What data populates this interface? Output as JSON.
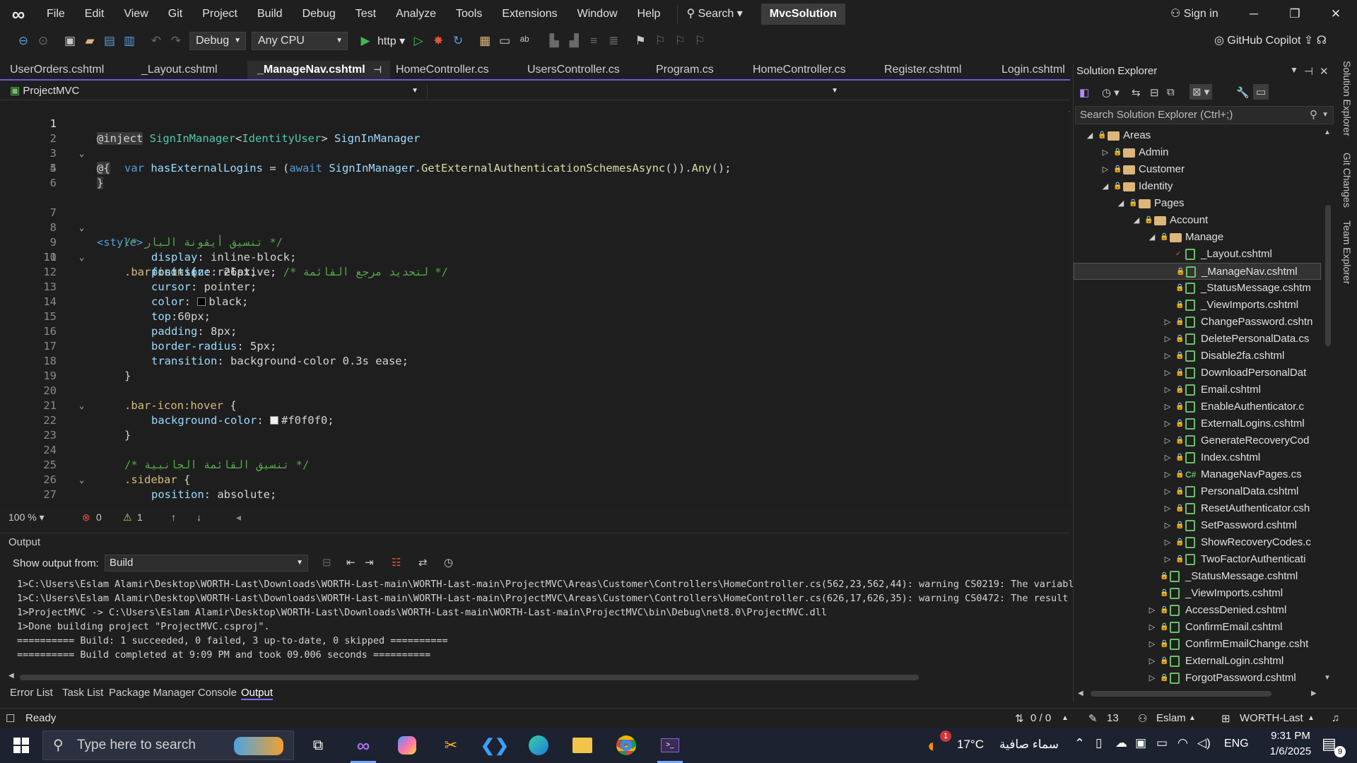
{
  "menu": {
    "items": [
      "File",
      "Edit",
      "View",
      "Git",
      "Project",
      "Build",
      "Debug",
      "Test",
      "Analyze",
      "Tools",
      "Extensions",
      "Window",
      "Help"
    ],
    "search_label": "Search",
    "solution_name": "MvcSolution",
    "sign_in": "Sign in"
  },
  "toolbar": {
    "config": "Debug",
    "platform": "Any CPU",
    "run_target": "http",
    "copilot": "GitHub Copilot"
  },
  "tabs": [
    {
      "label": "UserOrders.cshtml",
      "active": false
    },
    {
      "label": "_Layout.cshtml",
      "active": false
    },
    {
      "label": "_ManageNav.cshtml",
      "active": true
    },
    {
      "label": "HomeController.cs",
      "active": false
    },
    {
      "label": "UsersController.cs",
      "active": false
    },
    {
      "label": "Program.cs",
      "active": false
    },
    {
      "label": "HomeController.cs",
      "active": false
    },
    {
      "label": "Register.cshtml",
      "active": false
    },
    {
      "label": "Login.cshtml",
      "active": false
    }
  ],
  "navbar": {
    "project": "ProjectMVC"
  },
  "code": {
    "line_numbers": [
      "1",
      "2",
      "3",
      "4",
      "5",
      "6",
      "7",
      "8",
      "9",
      "10",
      "11",
      "12",
      "13",
      "14",
      "15",
      "16",
      "17",
      "18",
      "19",
      "20",
      "21",
      "22",
      "23",
      "24",
      "25",
      "26",
      "27"
    ],
    "l1": {
      "a": "@inject",
      "b": " SignInManager",
      "c": "<",
      "d": "IdentityUser",
      "e": "> ",
      "f": "SignInManager"
    },
    "l2": "@{",
    "l3": {
      "a": "var",
      "b": " hasExternalLogins",
      "c": " = (",
      "d": "await",
      "e": " SignInManager",
      "f": ".",
      "g": "GetExternalAuthenticationSchemesAsync",
      "h": "()).",
      "i": "Any",
      "j": "();"
    },
    "l4": "}",
    "l7": "<style>",
    "l8": "/* تنسيق أيقونة البار */",
    "l9": {
      "sel": ".bar-icon",
      "rest": " {"
    },
    "l10": {
      "p": "position",
      "v": ": relative; ",
      "c": "/* لتحديد مرجع القائمة */"
    },
    "l11": {
      "p": "display",
      "v": ": inline-block;"
    },
    "l12": {
      "p": "font-size",
      "v": ": 26px;"
    },
    "l13": {
      "p": "cursor",
      "v": ": pointer;"
    },
    "l14": {
      "p": "color",
      "v": "black;"
    },
    "l15": {
      "p": "top",
      "v": ":60px;"
    },
    "l16": {
      "p": "padding",
      "v": ": 8px;"
    },
    "l17": {
      "p": "border-radius",
      "v": ": 5px;"
    },
    "l18": {
      "p": "transition",
      "v": ": background-color 0.3s ease;"
    },
    "l19": "}",
    "l21": {
      "sel": ".bar-icon:hover",
      "rest": " {"
    },
    "l22": {
      "p": "background-color",
      "v": "#f0f0f0;"
    },
    "l23": "}",
    "l25": "/* تنسيق القائمة الجانبية */",
    "l26": {
      "sel": ".sidebar",
      "rest": " {"
    },
    "l27": {
      "p": "position",
      "v": ": absolute;"
    }
  },
  "editor_status": {
    "zoom": "100 %",
    "errors": "0",
    "warnings": "1"
  },
  "output": {
    "title": "Output",
    "show_from_label": "Show output from:",
    "source": "Build",
    "lines": [
      "1>C:\\Users\\Eslam Alamir\\Desktop\\WORTH-Last\\Downloads\\WORTH-Last-main\\WORTH-Last-main\\ProjectMVC\\Areas\\Customer\\Controllers\\HomeController.cs(562,23,562,44): warning CS0219: The variable",
      "1>C:\\Users\\Eslam Alamir\\Desktop\\WORTH-Last\\Downloads\\WORTH-Last-main\\WORTH-Last-main\\ProjectMVC\\Areas\\Customer\\Controllers\\HomeController.cs(626,17,626,35): warning CS0472: The result of",
      "1>ProjectMVC -> C:\\Users\\Eslam Alamir\\Desktop\\WORTH-Last\\Downloads\\WORTH-Last-main\\WORTH-Last-main\\ProjectMVC\\bin\\Debug\\net8.0\\ProjectMVC.dll",
      "1>Done building project \"ProjectMVC.csproj\".",
      "========== Build: 1 succeeded, 0 failed, 3 up-to-date, 0 skipped ==========",
      "========== Build completed at 9:09 PM and took 09.006 seconds =========="
    ]
  },
  "bottom_tabs": [
    "Error List",
    "Task List",
    "Package Manager Console",
    "Output"
  ],
  "solution_explorer": {
    "title": "Solution Explorer",
    "search_placeholder": "Search Solution Explorer (Ctrl+;)",
    "items": [
      {
        "label": "Areas",
        "kind": "folder",
        "expanded": true
      },
      {
        "label": "Admin",
        "kind": "folder",
        "expanded": false
      },
      {
        "label": "Customer",
        "kind": "folder",
        "expanded": false
      },
      {
        "label": "Identity",
        "kind": "folder",
        "expanded": true
      },
      {
        "label": "Pages",
        "kind": "folder",
        "expanded": true
      },
      {
        "label": "Account",
        "kind": "folder",
        "expanded": true
      },
      {
        "label": "Manage",
        "kind": "folder",
        "expanded": true
      },
      {
        "label": "_Layout.cshtml",
        "kind": "file"
      },
      {
        "label": "_ManageNav.cshtml",
        "kind": "file",
        "selected": true
      },
      {
        "label": "_StatusMessage.cshtm",
        "kind": "file"
      },
      {
        "label": "_ViewImports.cshtml",
        "kind": "file"
      },
      {
        "label": "ChangePassword.cshtn",
        "kind": "file"
      },
      {
        "label": "DeletePersonalData.cs",
        "kind": "file"
      },
      {
        "label": "Disable2fa.cshtml",
        "kind": "file"
      },
      {
        "label": "DownloadPersonalDat",
        "kind": "file"
      },
      {
        "label": "Email.cshtml",
        "kind": "file"
      },
      {
        "label": "EnableAuthenticator.c",
        "kind": "file"
      },
      {
        "label": "ExternalLogins.cshtml",
        "kind": "file"
      },
      {
        "label": "GenerateRecoveryCod",
        "kind": "file"
      },
      {
        "label": "Index.cshtml",
        "kind": "file"
      },
      {
        "label": "ManageNavPages.cs",
        "kind": "cs"
      },
      {
        "label": "PersonalData.cshtml",
        "kind": "file"
      },
      {
        "label": "ResetAuthenticator.csh",
        "kind": "file"
      },
      {
        "label": "SetPassword.cshtml",
        "kind": "file"
      },
      {
        "label": "ShowRecoveryCodes.c",
        "kind": "file"
      },
      {
        "label": "TwoFactorAuthenticati",
        "kind": "file"
      },
      {
        "label": "_StatusMessage.cshtml",
        "kind": "file"
      },
      {
        "label": "_ViewImports.cshtml",
        "kind": "file"
      },
      {
        "label": "AccessDenied.cshtml",
        "kind": "file"
      },
      {
        "label": "ConfirmEmail.cshtml",
        "kind": "file"
      },
      {
        "label": "ConfirmEmailChange.csht",
        "kind": "file"
      },
      {
        "label": "ExternalLogin.cshtml",
        "kind": "file"
      },
      {
        "label": "ForgotPassword.cshtml",
        "kind": "file"
      }
    ]
  },
  "side_tabs": [
    "Solution Explorer",
    "Git Changes",
    "Team Explorer"
  ],
  "status_bar": {
    "ready": "Ready",
    "lines": "0 / 0",
    "edits": "13",
    "user": "Eslam",
    "repo": "WORTH-Last"
  },
  "taskbar": {
    "search_placeholder": "Type here to search",
    "weather_temp": "17°C",
    "weather_desc": "سماء صافية",
    "weather_badge": "1",
    "language": "ENG",
    "time": "9:31 PM",
    "date": "1/6/2025",
    "notifications": "9"
  }
}
